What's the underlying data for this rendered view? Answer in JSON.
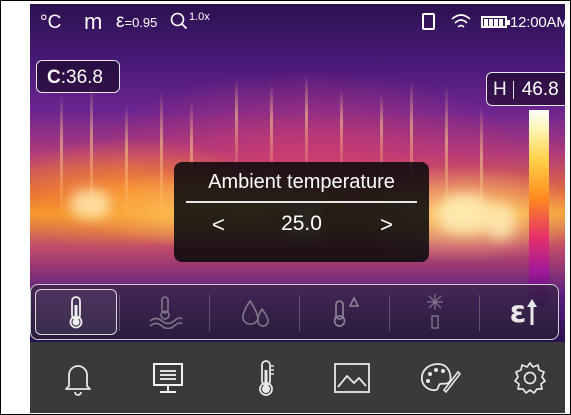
{
  "status_bar": {
    "unit": "°C",
    "mode": "m",
    "emissivity_symbol": "ε",
    "emissivity_value": "=0.95",
    "zoom_value": "1.0x",
    "battery_level": 1.0,
    "time": "12:00AM"
  },
  "readouts": {
    "center_label": "C",
    "center_value": ":36.8",
    "high_label": "H",
    "high_value": "46.8"
  },
  "dialog": {
    "title": "Ambient temperature",
    "prev_symbol": "<",
    "value": "25.0",
    "next_symbol": ">"
  },
  "function_bar": {
    "items": [
      {
        "icon": "thermometer-icon",
        "active": true
      },
      {
        "icon": "ambient-temperature-icon",
        "active": false
      },
      {
        "icon": "humidity-icon",
        "active": false
      },
      {
        "icon": "delta-temperature-icon",
        "active": false
      },
      {
        "icon": "reflected-temperature-icon",
        "active": false
      },
      {
        "icon": "emissivity-icon",
        "active": false
      }
    ],
    "emissivity_glyph": "ε"
  },
  "menu_bar": {
    "items": [
      {
        "icon": "bell-icon",
        "active": false
      },
      {
        "icon": "display-icon",
        "active": true
      },
      {
        "icon": "thermometer-icon",
        "active": false
      },
      {
        "icon": "image-icon",
        "active": false
      },
      {
        "icon": "palette-icon",
        "active": false
      },
      {
        "icon": "settings-icon",
        "active": false
      }
    ]
  },
  "colors": {
    "menubar_bg": "#3a3a3c",
    "icon_color": "#e8e8e8",
    "dialog_bg": "#0a0a0c"
  }
}
